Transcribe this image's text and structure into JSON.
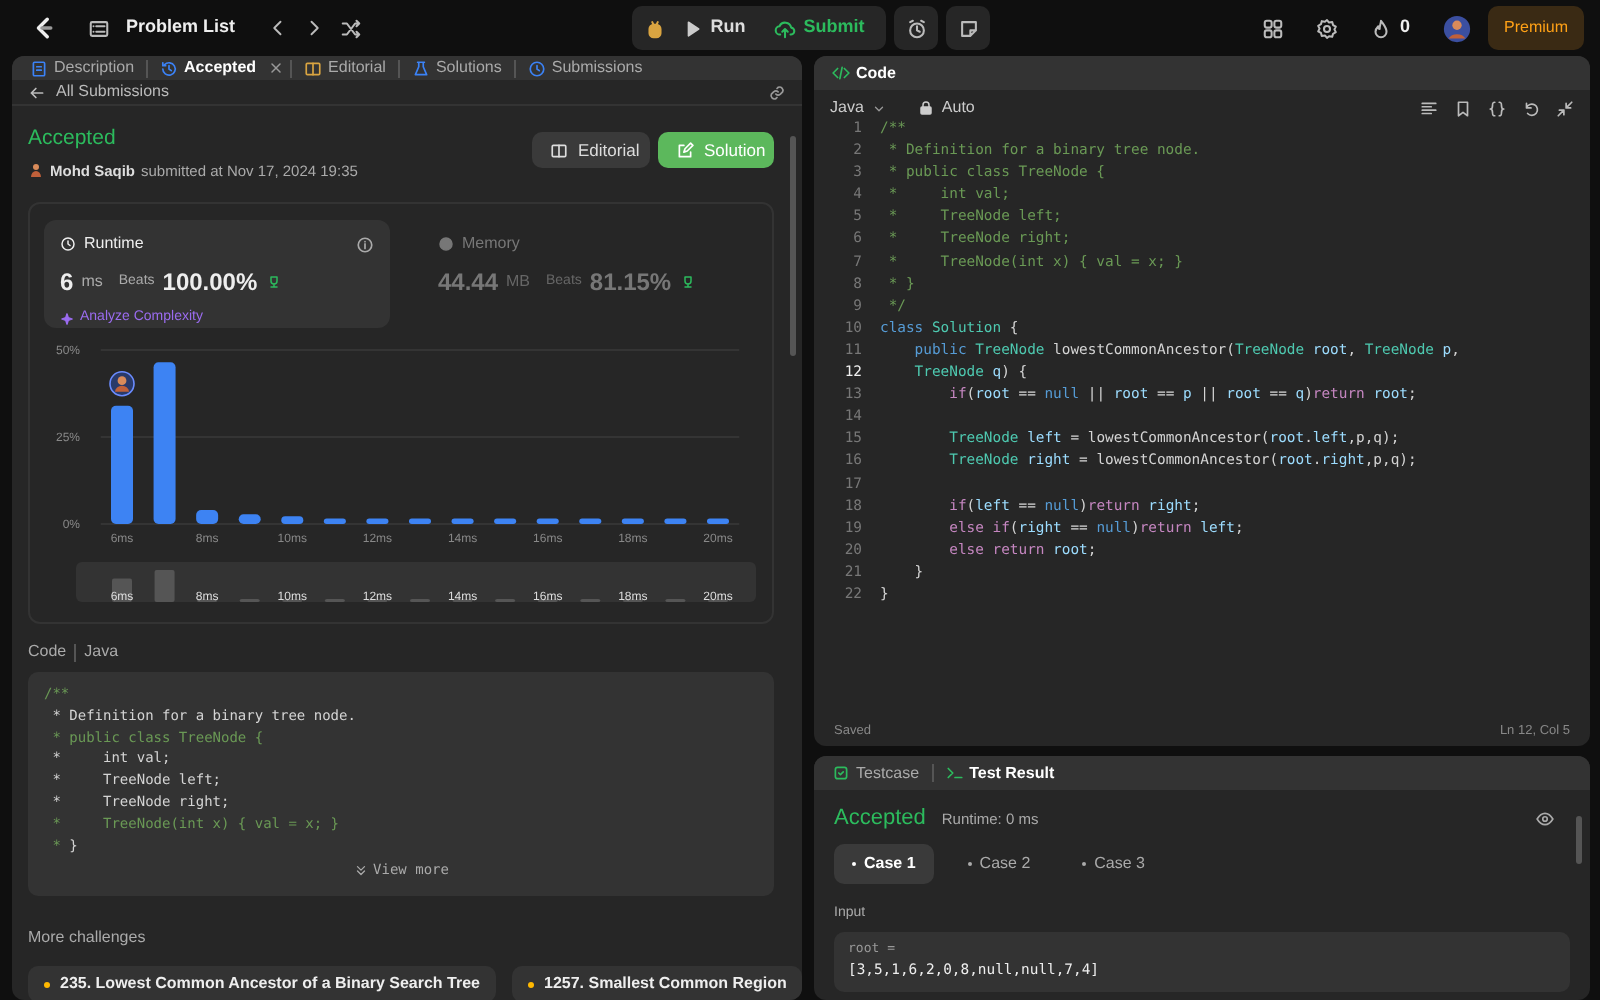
{
  "topbar": {
    "problem_list": "Problem List",
    "run": "Run",
    "submit": "Submit",
    "streak": "0",
    "premium": "Premium"
  },
  "left_tabs": [
    {
      "label": "Description",
      "selected": false,
      "closable": false
    },
    {
      "label": "Accepted",
      "selected": true,
      "closable": true
    },
    {
      "label": "Editorial",
      "selected": false,
      "closable": false
    },
    {
      "label": "Solutions",
      "selected": false,
      "closable": false
    },
    {
      "label": "Submissions",
      "selected": false,
      "closable": false
    }
  ],
  "back_link": "All Submissions",
  "submission": {
    "status": "Accepted",
    "user": "Mohd Saqib",
    "submitted": "submitted at Nov 17, 2024 19:35",
    "editorial_button": "Editorial",
    "solution_button": "Solution"
  },
  "stats": [
    {
      "label": "Runtime",
      "selected": true,
      "value": "6",
      "unit": "ms",
      "beats_label": "Beats",
      "beats": "100.00%"
    },
    {
      "label": "Memory",
      "selected": false,
      "value": "44.44",
      "unit": "MB",
      "beats_label": "Beats",
      "beats": "81.15%"
    }
  ],
  "analyze": "Analyze Complexity",
  "chart_data": {
    "type": "bar",
    "x": [
      6,
      7,
      8,
      9,
      10,
      11,
      12,
      13,
      14,
      15,
      16,
      17,
      18,
      19,
      20
    ],
    "xlim": [
      5.5,
      20.5
    ],
    "series": [
      {
        "color": "#3d83f3",
        "values": [
          34,
          46.5,
          4,
          2.8,
          2.2,
          1.6,
          1.6,
          1.6,
          1.6,
          1.6,
          1.6,
          1.6,
          1.6,
          1.6,
          1.6
        ]
      }
    ],
    "ylim": [
      0,
      50
    ],
    "yticks": [
      {
        "value": 0,
        "label": "0%"
      },
      {
        "value": 25,
        "label": "25%"
      },
      {
        "value": 50,
        "label": "50%"
      }
    ],
    "xticks": [
      {
        "value": 6,
        "label": "6ms"
      },
      {
        "value": 8,
        "label": "8ms"
      },
      {
        "value": 10,
        "label": "10ms"
      },
      {
        "value": 12,
        "label": "12ms"
      },
      {
        "value": 14,
        "label": "14ms"
      },
      {
        "value": 16,
        "label": "16ms"
      },
      {
        "value": 18,
        "label": "18ms"
      },
      {
        "value": 20,
        "label": "20ms"
      }
    ]
  },
  "brush_labels": [
    "6ms",
    "8ms",
    "10ms",
    "12ms",
    "14ms",
    "16ms",
    "18ms",
    "20ms"
  ],
  "code_section": {
    "title": "Code",
    "language": "Java"
  },
  "code_preview": [
    [
      {
        "text": "/**",
        "kind": "c"
      }
    ],
    [
      {
        "text": " * Definition for a binary tree node.",
        "kind": "w"
      }
    ],
    [
      {
        "text": " * public class TreeNode {",
        "kind": "c"
      }
    ],
    [
      {
        "text": " *     int val;",
        "kind": "w"
      }
    ],
    [
      {
        "text": " *     TreeNode left;",
        "kind": "w"
      }
    ],
    [
      {
        "text": " *     TreeNode right;",
        "kind": "w"
      }
    ],
    [
      {
        "text": " *     TreeNode(int x) { val = x; }",
        "kind": "c"
      }
    ],
    [
      {
        "text": " * ",
        "kind": "c"
      },
      {
        "text": "}",
        "kind": "w"
      }
    ]
  ],
  "view_more": "View more",
  "more_challenges": {
    "title": "More challenges",
    "items": [
      "235. Lowest Common Ancestor of a Binary Search Tree",
      "1257. Smallest Common Region"
    ]
  },
  "editor": {
    "title": "Code",
    "language": "Java",
    "mode": "Auto",
    "status": "Saved",
    "position": "Ln 12, Col 5",
    "lines": [
      {
        "number": "1",
        "current": false,
        "tokens": [
          {
            "text": "/**",
            "kind": "c"
          }
        ]
      },
      {
        "number": "2",
        "current": false,
        "tokens": [
          {
            "text": " * Definition for a binary tree node.",
            "kind": "c"
          }
        ]
      },
      {
        "number": "3",
        "current": false,
        "tokens": [
          {
            "text": " * public class TreeNode {",
            "kind": "c"
          }
        ]
      },
      {
        "number": "4",
        "current": false,
        "tokens": [
          {
            "text": " *     int val;",
            "kind": "c"
          }
        ]
      },
      {
        "number": "5",
        "current": false,
        "tokens": [
          {
            "text": " *     TreeNode left;",
            "kind": "c"
          }
        ]
      },
      {
        "number": "6",
        "current": false,
        "tokens": [
          {
            "text": " *     TreeNode right;",
            "kind": "c"
          }
        ]
      },
      {
        "number": "7",
        "current": false,
        "tokens": [
          {
            "text": " *     TreeNode(int x) { val = x; }",
            "kind": "c"
          }
        ]
      },
      {
        "number": "8",
        "current": false,
        "tokens": [
          {
            "text": " * }",
            "kind": "c"
          }
        ]
      },
      {
        "number": "9",
        "current": false,
        "tokens": [
          {
            "text": " */",
            "kind": "c"
          }
        ]
      },
      {
        "number": "10",
        "current": false,
        "tokens": [
          {
            "text": "class",
            "kind": "k"
          },
          {
            "text": " Solution",
            "kind": "t"
          },
          {
            "text": " {",
            "kind": "w"
          }
        ]
      },
      {
        "number": "11",
        "current": false,
        "tokens": [
          {
            "text": "    public",
            "kind": "k"
          },
          {
            "text": " TreeNode",
            "kind": "t"
          },
          {
            "text": " lowestCommonAncestor(",
            "kind": "w"
          },
          {
            "text": "TreeNode",
            "kind": "t"
          },
          {
            "text": " root",
            "kind": "v"
          },
          {
            "text": ", ",
            "kind": "w"
          },
          {
            "text": "TreeNode",
            "kind": "t"
          },
          {
            "text": " p",
            "kind": "v"
          },
          {
            "text": ",",
            "kind": "w"
          }
        ]
      },
      {
        "number": "12",
        "current": true,
        "tokens": [
          {
            "text": "    TreeNode",
            "kind": "t"
          },
          {
            "text": " q",
            "kind": "v"
          },
          {
            "text": ") {",
            "kind": "w"
          }
        ]
      },
      {
        "number": "13",
        "current": false,
        "tokens": [
          {
            "text": "        if",
            "kind": "r"
          },
          {
            "text": "(",
            "kind": "w"
          },
          {
            "text": "root",
            "kind": "v"
          },
          {
            "text": " == ",
            "kind": "w"
          },
          {
            "text": "null",
            "kind": "k"
          },
          {
            "text": " || ",
            "kind": "w"
          },
          {
            "text": "root",
            "kind": "v"
          },
          {
            "text": " == ",
            "kind": "w"
          },
          {
            "text": "p",
            "kind": "v"
          },
          {
            "text": " || ",
            "kind": "w"
          },
          {
            "text": "root",
            "kind": "v"
          },
          {
            "text": " == ",
            "kind": "w"
          },
          {
            "text": "q",
            "kind": "v"
          },
          {
            "text": ")",
            "kind": "w"
          },
          {
            "text": "return",
            "kind": "r"
          },
          {
            "text": " root",
            "kind": "v"
          },
          {
            "text": ";",
            "kind": "w"
          }
        ]
      },
      {
        "number": "14",
        "current": false
      },
      {
        "number": "15",
        "current": false,
        "tokens": [
          {
            "text": "        TreeNode",
            "kind": "t"
          },
          {
            "text": " left",
            "kind": "v"
          },
          {
            "text": " = lowestCommonAncestor(",
            "kind": "w"
          },
          {
            "text": "root",
            "kind": "v"
          },
          {
            "text": ".",
            "kind": "w"
          },
          {
            "text": "left",
            "kind": "v"
          },
          {
            "text": ",p,q);",
            "kind": "w"
          }
        ]
      },
      {
        "number": "16",
        "current": false,
        "tokens": [
          {
            "text": "        TreeNode",
            "kind": "t"
          },
          {
            "text": " right",
            "kind": "v"
          },
          {
            "text": " = lowestCommonAncestor(",
            "kind": "w"
          },
          {
            "text": "root",
            "kind": "v"
          },
          {
            "text": ".",
            "kind": "w"
          },
          {
            "text": "right",
            "kind": "v"
          },
          {
            "text": ",p,q);",
            "kind": "w"
          }
        ]
      },
      {
        "number": "17",
        "current": false
      },
      {
        "number": "18",
        "current": false,
        "tokens": [
          {
            "text": "        if",
            "kind": "r"
          },
          {
            "text": "(",
            "kind": "w"
          },
          {
            "text": "left",
            "kind": "v"
          },
          {
            "text": " == ",
            "kind": "w"
          },
          {
            "text": "null",
            "kind": "k"
          },
          {
            "text": ")",
            "kind": "w"
          },
          {
            "text": "return",
            "kind": "r"
          },
          {
            "text": " right",
            "kind": "v"
          },
          {
            "text": ";",
            "kind": "w"
          }
        ]
      },
      {
        "number": "19",
        "current": false,
        "tokens": [
          {
            "text": "        else",
            "kind": "r"
          },
          {
            "text": " if",
            "kind": "r"
          },
          {
            "text": "(",
            "kind": "w"
          },
          {
            "text": "right",
            "kind": "v"
          },
          {
            "text": " == ",
            "kind": "w"
          },
          {
            "text": "null",
            "kind": "k"
          },
          {
            "text": ")",
            "kind": "w"
          },
          {
            "text": "return",
            "kind": "r"
          },
          {
            "text": " left",
            "kind": "v"
          },
          {
            "text": ";",
            "kind": "w"
          }
        ]
      },
      {
        "number": "20",
        "current": false,
        "tokens": [
          {
            "text": "        else",
            "kind": "r"
          },
          {
            "text": " return",
            "kind": "r"
          },
          {
            "text": " root",
            "kind": "v"
          },
          {
            "text": ";",
            "kind": "w"
          }
        ]
      },
      {
        "number": "21",
        "current": false,
        "tokens": [
          {
            "text": "    }",
            "kind": "w"
          }
        ]
      },
      {
        "number": "22",
        "current": false,
        "tokens": [
          {
            "text": "}",
            "kind": "w"
          }
        ]
      }
    ]
  },
  "result_tabs": [
    {
      "label": "Testcase",
      "selected": false
    },
    {
      "label": "Test Result",
      "selected": true
    }
  ],
  "result": {
    "status": "Accepted",
    "runtime": "Runtime: 0 ms",
    "cases": [
      {
        "label": "Case 1",
        "selected": true
      },
      {
        "label": "Case 2",
        "selected": false
      },
      {
        "label": "Case 3",
        "selected": false
      }
    ],
    "input_label": "Input",
    "param": "root =",
    "value": "[3,5,1,6,2,0,8,null,null,7,4]"
  }
}
